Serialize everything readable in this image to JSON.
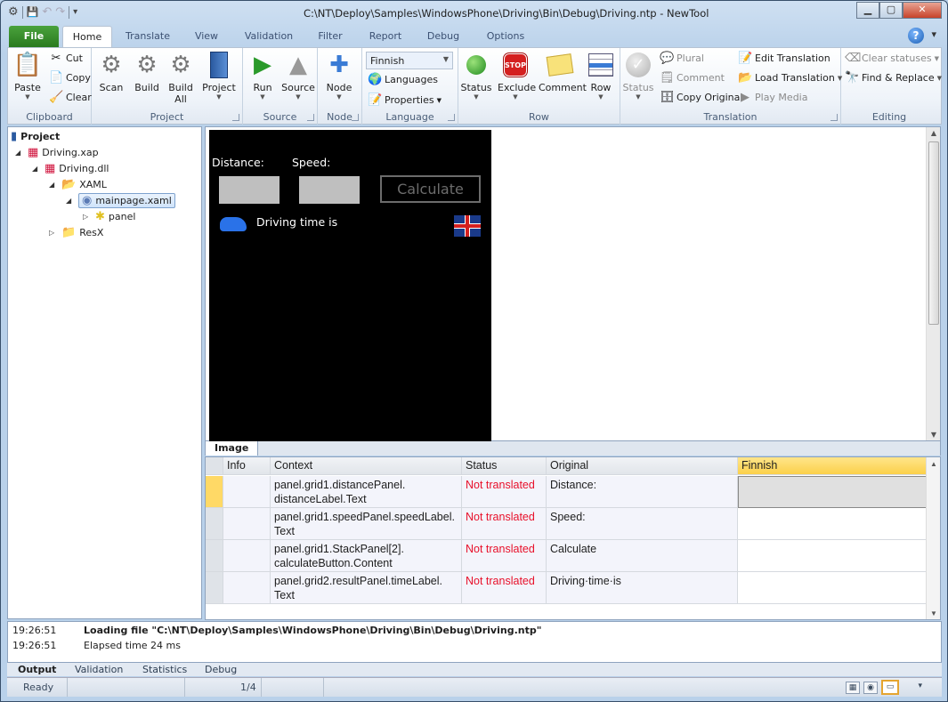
{
  "window": {
    "title": "C:\\NT\\Deploy\\Samples\\WindowsPhone\\Driving\\Bin\\Debug\\Driving.ntp - NewTool",
    "controls": {
      "minimize": "▁",
      "maximize": "▢",
      "close": "✕"
    }
  },
  "qat": {
    "app_icon": "⚙",
    "save": "💾",
    "undo": "↶",
    "redo": "↷",
    "customize": "▾"
  },
  "tabs": [
    {
      "label": "File"
    },
    {
      "label": "Home"
    },
    {
      "label": "Translate"
    },
    {
      "label": "View"
    },
    {
      "label": "Validation"
    },
    {
      "label": "Filter"
    },
    {
      "label": "Report"
    },
    {
      "label": "Debug"
    },
    {
      "label": "Options"
    }
  ],
  "help": {
    "label": "?",
    "dropdown": "▾"
  },
  "ribbon": {
    "clipboard": {
      "label": "Clipboard",
      "paste": "Paste",
      "cut": "Cut",
      "copy": "Copy",
      "clear": "Clear"
    },
    "project": {
      "label": "Project",
      "scan": "Scan",
      "build": "Build",
      "build_all_1": "Build",
      "build_all_2": "All",
      "project": "Project"
    },
    "source": {
      "label": "Source",
      "run": "Run",
      "source": "Source"
    },
    "node": {
      "label": "Node",
      "node": "Node"
    },
    "language": {
      "label": "Language",
      "selected": "Finnish",
      "languages": "Languages",
      "properties": "Properties"
    },
    "row": {
      "label": "Row",
      "status": "Status",
      "exclude": "Exclude",
      "exclude_icon": "STOP",
      "comment": "Comment",
      "row": "Row"
    },
    "translation": {
      "label": "Translation",
      "status": "Status",
      "plural": "Plural",
      "comment": "Comment",
      "copy_original": "Copy Original",
      "edit_translation": "Edit Translation",
      "load_translation": "Load Translation",
      "play_media": "Play Media"
    },
    "editing": {
      "label": "Editing",
      "clear_statuses": "Clear statuses",
      "find_replace": "Find & Replace"
    }
  },
  "tree": {
    "root": "Project",
    "items": [
      {
        "label": "Driving.xap"
      },
      {
        "label": "Driving.dll"
      },
      {
        "label": "XAML"
      },
      {
        "label": "mainpage.xaml"
      },
      {
        "label": "panel"
      },
      {
        "label": "ResX"
      }
    ]
  },
  "preview": {
    "distance_label": "Distance:",
    "speed_label": "Speed:",
    "calculate": "Calculate",
    "result": "Driving time is",
    "tab": "Image"
  },
  "grid": {
    "columns": [
      "Info",
      "Context",
      "Status",
      "Original",
      "Finnish"
    ],
    "rows": [
      {
        "context1": "panel.grid1.distancePanel.",
        "context2": "distanceLabel.Text",
        "status": "Not translated",
        "original": "Distance:",
        "translation": ""
      },
      {
        "context1": "panel.grid1.speedPanel.speedLabel.",
        "context2": "Text",
        "status": "Not translated",
        "original": "Speed:",
        "translation": ""
      },
      {
        "context1": "panel.grid1.StackPanel[2].",
        "context2": "calculateButton.Content",
        "status": "Not translated",
        "original": "Calculate",
        "translation": ""
      },
      {
        "context1": "panel.grid2.resultPanel.timeLabel.",
        "context2": "Text",
        "status": "Not translated",
        "original": "Driving·time·is",
        "translation": ""
      }
    ]
  },
  "output": {
    "lines": [
      {
        "time": "19:26:51",
        "text": "Loading file \"C:\\NT\\Deploy\\Samples\\WindowsPhone\\Driving\\Bin\\Debug\\Driving.ntp\""
      },
      {
        "time": "19:26:51",
        "text": "Elapsed time 24 ms"
      }
    ],
    "tabs": [
      "Output",
      "Validation",
      "Statistics",
      "Debug"
    ]
  },
  "statusbar": {
    "state": "Ready",
    "position": "1/4"
  },
  "colors": {
    "accent_green": "#2a7a1f",
    "not_translated": "#e8102a",
    "selected_column": "#fbd04a"
  }
}
